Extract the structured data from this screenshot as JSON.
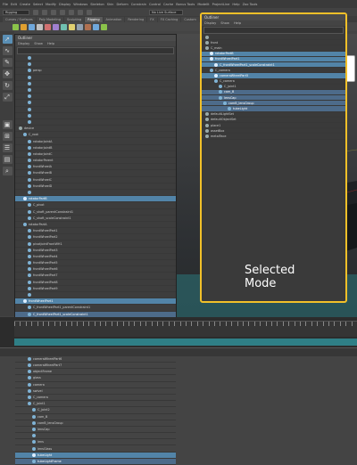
{
  "menubar": [
    "File",
    "Edit",
    "Create",
    "Select",
    "Modify",
    "Display",
    "Windows",
    "Skeleton",
    "Skin",
    "Deform",
    "Constrain",
    "Control",
    "Cache",
    "Bonus Tools",
    "ModelIt",
    "ProjectLine",
    "Help",
    "Zoo Tools"
  ],
  "workspace": "Rigging",
  "live_surface": "No Live Surface",
  "shelf_tabs": [
    "Curves / Surfaces",
    "Poly Modeling",
    "Sculpting",
    "Rigging",
    "Animation",
    "Rendering",
    "FX",
    "FX Caching",
    "Custom",
    "Arnold",
    "Bifrost",
    "MASH",
    "Motion Graphics",
    "XGen"
  ],
  "outliner_main": {
    "title": "Outliner",
    "menus": [
      "Display",
      "Show",
      "Help"
    ],
    "rows": [
      {
        "label": "",
        "state": "normal",
        "depth": 2
      },
      {
        "label": "",
        "state": "normal",
        "depth": 2
      },
      {
        "label": "persp",
        "state": "normal",
        "depth": 2
      },
      {
        "label": "",
        "state": "normal",
        "depth": 2
      },
      {
        "label": "",
        "state": "normal",
        "depth": 2
      },
      {
        "label": "",
        "state": "normal",
        "depth": 2
      },
      {
        "label": "",
        "state": "normal",
        "depth": 2
      },
      {
        "label": "",
        "state": "normal",
        "depth": 2
      },
      {
        "label": "",
        "state": "normal",
        "depth": 2
      },
      {
        "label": "",
        "state": "normal",
        "depth": 2
      },
      {
        "label": "",
        "state": "normal",
        "depth": 2
      },
      {
        "label": "device",
        "state": "normal",
        "depth": 0
      },
      {
        "label": "C_root",
        "state": "normal",
        "depth": 1
      },
      {
        "label": "rotatorJointA",
        "state": "normal",
        "depth": 2
      },
      {
        "label": "rotatorJointB",
        "state": "normal",
        "depth": 2
      },
      {
        "label": "rotatorJointC",
        "state": "normal",
        "depth": 2
      },
      {
        "label": "rotatorParent",
        "state": "normal",
        "depth": 2
      },
      {
        "label": "frontWheelA",
        "state": "normal",
        "depth": 2
      },
      {
        "label": "frontWheelB",
        "state": "normal",
        "depth": 2
      },
      {
        "label": "frontWheelC",
        "state": "normal",
        "depth": 2
      },
      {
        "label": "frontWheelD",
        "state": "normal",
        "depth": 2
      },
      {
        "label": "",
        "state": "normal",
        "depth": 2
      },
      {
        "label": "rotatorPartB",
        "state": "sel",
        "depth": 1
      },
      {
        "label": "C_pivot",
        "state": "normal",
        "depth": 2
      },
      {
        "label": "C_shaft_parentConstraint1",
        "state": "normal",
        "depth": 2
      },
      {
        "label": "C_shaft_scaleConstraint1",
        "state": "normal",
        "depth": 2
      },
      {
        "label": "rotatorPartA",
        "state": "normal",
        "depth": 1
      },
      {
        "label": "frontWheelPart1",
        "state": "normal",
        "depth": 2
      },
      {
        "label": "frontWheelPart2",
        "state": "normal",
        "depth": 2
      },
      {
        "label": "pivotJointFrontWH1",
        "state": "normal",
        "depth": 2
      },
      {
        "label": "frontWheelPart3",
        "state": "normal",
        "depth": 2
      },
      {
        "label": "frontWheelPart4",
        "state": "normal",
        "depth": 2
      },
      {
        "label": "frontWheelPart5",
        "state": "normal",
        "depth": 2
      },
      {
        "label": "frontWheelPart6",
        "state": "normal",
        "depth": 2
      },
      {
        "label": "frontWheelPart7",
        "state": "normal",
        "depth": 2
      },
      {
        "label": "frontWheelPart8",
        "state": "normal",
        "depth": 2
      },
      {
        "label": "frontWheelPart9",
        "state": "normal",
        "depth": 2
      },
      {
        "label": "",
        "state": "normal",
        "depth": 2
      },
      {
        "label": "frontWheelPart1",
        "state": "sel",
        "depth": 1
      },
      {
        "label": "C_frontWheelPart1_parentConstraint1",
        "state": "normal",
        "depth": 2
      },
      {
        "label": "C_frontWheelPart1_scaleConstraint1",
        "state": "hi",
        "depth": 2
      },
      {
        "label": "C_camera",
        "state": "normal",
        "depth": 1
      },
      {
        "label": "cameraWheelPart1",
        "state": "normal",
        "depth": 2
      },
      {
        "label": "cameraWheelPart2",
        "state": "normal",
        "depth": 2
      },
      {
        "label": "cameraWheelPart3",
        "state": "normal",
        "depth": 2
      },
      {
        "label": "cameraWheelPart4",
        "state": "normal",
        "depth": 2
      },
      {
        "label": "cameraWheelPart5",
        "state": "sel",
        "depth": 1
      },
      {
        "label": "cameraWheelPart6",
        "state": "normal",
        "depth": 2
      },
      {
        "label": "cameraWheelPart7",
        "state": "normal",
        "depth": 2
      },
      {
        "label": "objectFrame",
        "state": "normal",
        "depth": 2
      },
      {
        "label": "glass",
        "state": "normal",
        "depth": 2
      },
      {
        "label": "camera",
        "state": "normal",
        "depth": 2
      },
      {
        "label": "swivel",
        "state": "normal",
        "depth": 2
      },
      {
        "label": "C_camera",
        "state": "normal",
        "depth": 2
      },
      {
        "label": "C_joint1",
        "state": "normal",
        "depth": 2
      },
      {
        "label": "C_joint2",
        "state": "normal",
        "depth": 3
      },
      {
        "label": "cam_B",
        "state": "normal",
        "depth": 3
      },
      {
        "label": "camB_lensGroup",
        "state": "normal",
        "depth": 3
      },
      {
        "label": "lensCap",
        "state": "normal",
        "depth": 3
      },
      {
        "label": "",
        "state": "normal",
        "depth": 3
      },
      {
        "label": "lens",
        "state": "normal",
        "depth": 3
      },
      {
        "label": "lensGlass",
        "state": "normal",
        "depth": 3
      },
      {
        "label": "tubeLight",
        "state": "sel",
        "depth": 3
      },
      {
        "label": "tubeLightFrame",
        "state": "hi",
        "depth": 3
      }
    ]
  },
  "outliner_overlay": {
    "title": "Outliner",
    "menus": [
      "Display",
      "Show",
      "Help"
    ],
    "rows": [
      {
        "label": "",
        "state": "normal",
        "depth": 0
      },
      {
        "label": "front",
        "state": "normal",
        "depth": 0
      },
      {
        "label": "C_main",
        "state": "normal",
        "depth": 0
      },
      {
        "label": "rotatorPartB",
        "state": "sel",
        "depth": 1
      },
      {
        "label": "frontWheelPart1",
        "state": "sel",
        "depth": 1
      },
      {
        "label": "C_frontWheelPart1_scaleConstraint1",
        "state": "sel",
        "depth": 2
      },
      {
        "label": "C_camera",
        "state": "normal",
        "depth": 1
      },
      {
        "label": "cameraWheelPart5",
        "state": "sel",
        "depth": 2
      },
      {
        "label": "C_camera",
        "state": "normal",
        "depth": 2
      },
      {
        "label": "C_joint1",
        "state": "normal",
        "depth": 3
      },
      {
        "label": "cam_B",
        "state": "hi",
        "depth": 3
      },
      {
        "label": "lensCap",
        "state": "hi",
        "depth": 3
      },
      {
        "label": "camB_lensGroup",
        "state": "hi",
        "depth": 4
      },
      {
        "label": "tubeLight",
        "state": "hi",
        "depth": 5
      },
      {
        "label": "defaultLightSet",
        "state": "normal",
        "depth": 0
      },
      {
        "label": "defaultObjectSet",
        "state": "normal",
        "depth": 0
      },
      {
        "label": "place1",
        "state": "normal",
        "depth": 0
      },
      {
        "label": "assetBox",
        "state": "normal",
        "depth": 0
      },
      {
        "label": "metalFace",
        "state": "normal",
        "depth": 0
      }
    ]
  },
  "annotation": {
    "text": "Selected\nMode",
    "color": "#f2c029"
  }
}
